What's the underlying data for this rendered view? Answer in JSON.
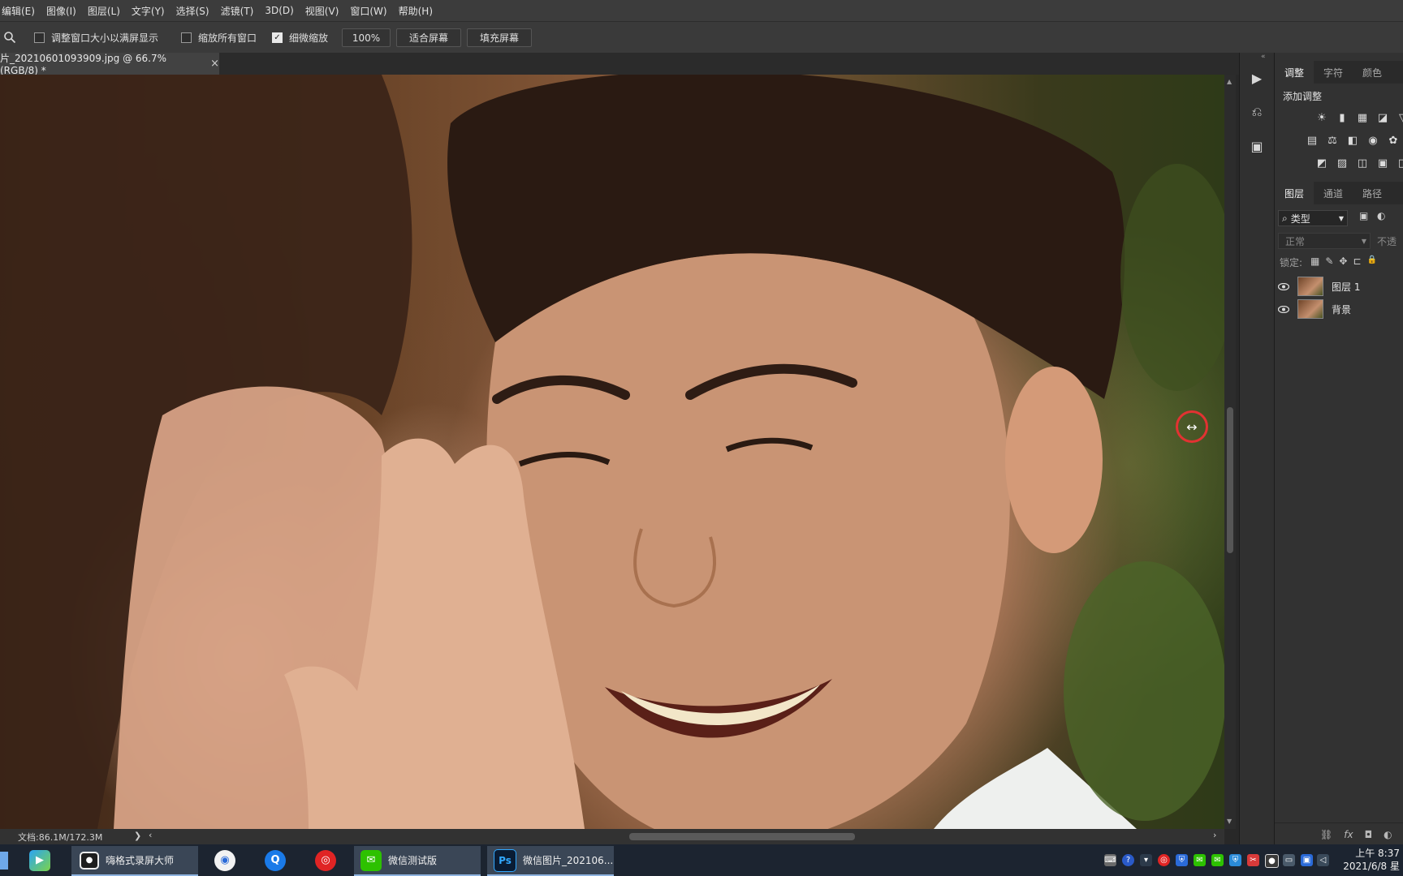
{
  "menu": [
    "编辑(E)",
    "图像(I)",
    "图层(L)",
    "文字(Y)",
    "选择(S)",
    "滤镜(T)",
    "3D(D)",
    "视图(V)",
    "窗口(W)",
    "帮助(H)"
  ],
  "options": {
    "zoom_tool_icon": "magnifier-icon",
    "resize_windows": {
      "label": "调整窗口大小以满屏显示",
      "checked": false
    },
    "zoom_all_windows": {
      "label": "缩放所有窗口",
      "checked": false
    },
    "scrubby_zoom": {
      "label": "细微缩放",
      "checked": true
    },
    "zoom_100": "100%",
    "fit_screen": "适合屏幕",
    "fill_screen": "填充屏幕"
  },
  "document": {
    "tab_title": "片_20210601093909.jpg @ 66.7%(RGB/8) *",
    "close_glyph": "×"
  },
  "status": {
    "doc_size": "文档:86.1M/172.3M",
    "arrow": "❯",
    "left_arrow": "‹",
    "right_arrow": "›"
  },
  "panels": {
    "adjust_tabs": [
      "调整",
      "字符",
      "颜色"
    ],
    "add_adjustment": "添加调整",
    "adjust_icons_row1": [
      "☀",
      "▮",
      "▦",
      "◪",
      "▽"
    ],
    "adjust_icons_row2": [
      "▤",
      "⚖",
      "◧",
      "◉",
      "✿",
      "▥"
    ],
    "adjust_icons_row3": [
      "◩",
      "▨",
      "◫",
      "▣",
      "◨"
    ],
    "layer_tabs": [
      "图层",
      "通道",
      "路径"
    ],
    "filter_kind": "类型",
    "blend_mode": "正常",
    "opacity_label": "不透",
    "lock_label": "锁定:",
    "lock_icons": [
      "▦",
      "✎",
      "✥",
      "⊏",
      "🔒"
    ],
    "layers": [
      {
        "name": "图层 1",
        "visible": true
      },
      {
        "name": "背景",
        "visible": true
      }
    ],
    "bottom_icons": [
      "⛓",
      "fx",
      "◘",
      "◐"
    ]
  },
  "taskbar": {
    "recorder": "嗨格式录屏大师",
    "wechat": "微信测试版",
    "photoshop": "微信图片_202106...",
    "ps_icon": "Ps",
    "clock_time": "上午 8:37",
    "clock_date": "2021/6/8 星"
  },
  "colors": {
    "ps_blue": "#31a8ff",
    "wechat_green": "#2dc100",
    "netease_red": "#e02424"
  }
}
